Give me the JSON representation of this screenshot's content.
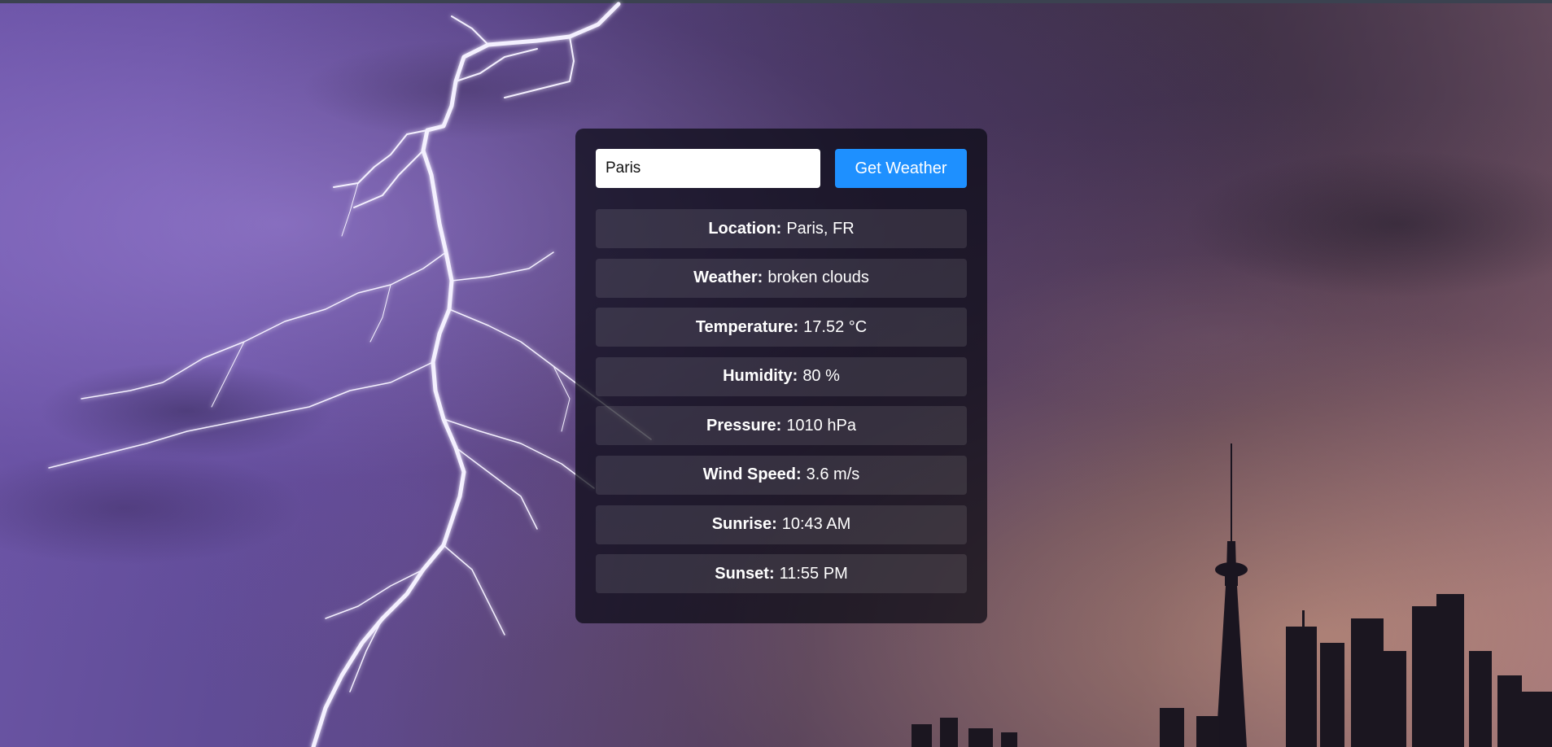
{
  "search": {
    "value": "Paris",
    "button_label": "Get Weather"
  },
  "weather": [
    {
      "label": "Location:",
      "value": "Paris, FR"
    },
    {
      "label": "Weather:",
      "value": "broken clouds"
    },
    {
      "label": "Temperature:",
      "value": "17.52 °C"
    },
    {
      "label": "Humidity:",
      "value": "80 %"
    },
    {
      "label": "Pressure:",
      "value": "1010 hPa"
    },
    {
      "label": "Wind Speed:",
      "value": "3.6 m/s"
    },
    {
      "label": "Sunrise:",
      "value": "10:43 AM"
    },
    {
      "label": "Sunset:",
      "value": "11:55 PM"
    }
  ],
  "colors": {
    "button": "#1e90ff",
    "card_background": "rgba(10,10,20,0.72)",
    "background_theme": "lightning storm over city skyline"
  }
}
